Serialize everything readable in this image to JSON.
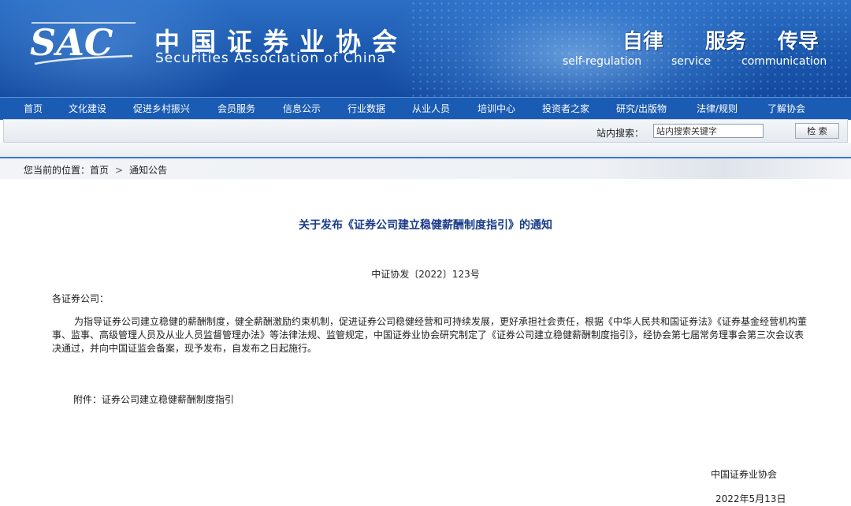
{
  "header": {
    "logo_text": "SAC",
    "org_name_cn": "中国证券业协会",
    "org_name_en": "Securities Association of China",
    "slogans": [
      {
        "cn": "自律",
        "en": "self-regulation"
      },
      {
        "cn": "服务",
        "en": "service"
      },
      {
        "cn": "传导",
        "en": "communication"
      }
    ]
  },
  "nav": {
    "items": [
      "首页",
      "文化建设",
      "促进乡村振兴",
      "会员服务",
      "信息公示",
      "行业数据",
      "从业人员",
      "培训中心",
      "投资者之家",
      "研究/出版物",
      "法律/规则",
      "了解协会"
    ]
  },
  "search": {
    "label": "站内搜索：",
    "placeholder": "站内搜索关键字",
    "button": "检 索"
  },
  "breadcrumb": {
    "prefix": "您当前的位置：",
    "home": "首页",
    "separator": ">",
    "current": "通知公告"
  },
  "article": {
    "title": "关于发布《证券公司建立稳健薪酬制度指引》的通知",
    "doc_number": "中证协发〔2022〕123号",
    "salutation": "各证券公司：",
    "body": "为指导证券公司建立稳健的薪酬制度，健全薪酬激励约束机制，促进证券公司稳健经营和可持续发展，更好承担社会责任，根据《中华人民共和国证券法》《证券基金经营机构董事、监事、高级管理人员及从业人员监督管理办法》等法律法规、监管规定，中国证券业协会研究制定了《证券公司建立稳健薪酬制度指引》，经协会第七届常务理事会第三次会议表决通过，并向中国证监会备案，现予发布，自发布之日起施行。",
    "attachment": "附件：证券公司建立稳健薪酬制度指引",
    "signature_org": "中国证券业协会",
    "signature_date": "2022年5月13日"
  },
  "colors": {
    "banner_blue": "#1b58ad",
    "nav_blue": "#1a5bb3",
    "title_blue": "#1a3c8a"
  }
}
